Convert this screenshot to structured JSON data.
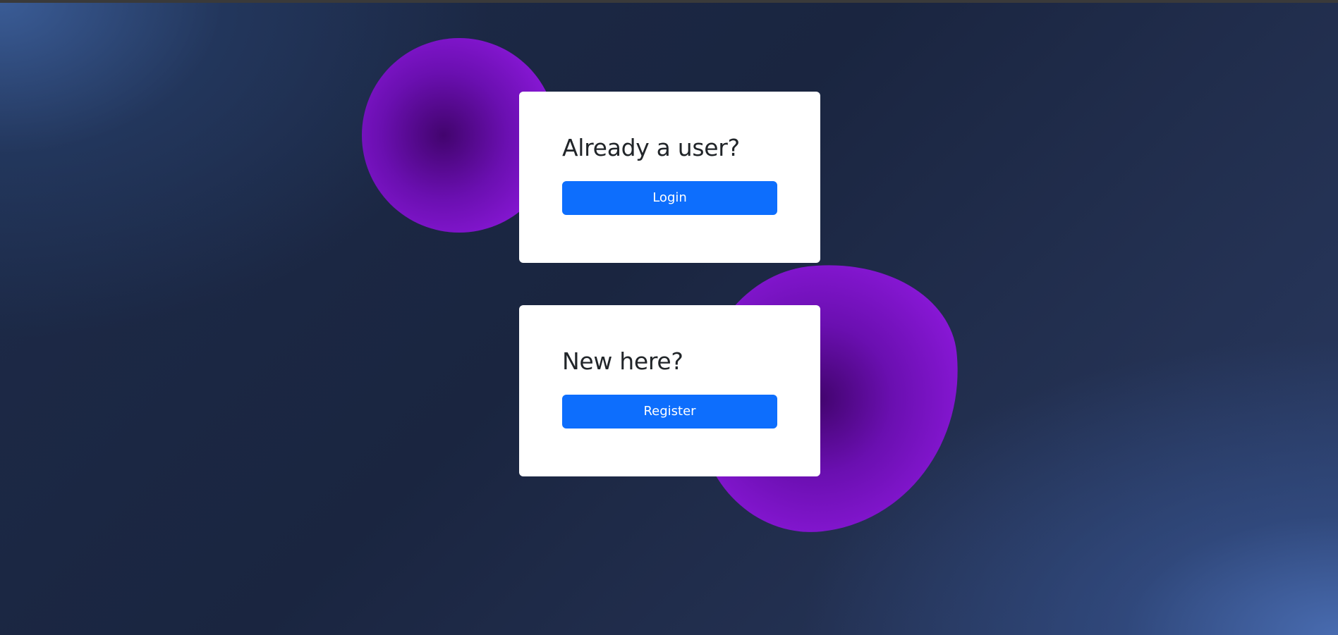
{
  "login_card": {
    "heading": "Already a user?",
    "button_label": "Login"
  },
  "register_card": {
    "heading": "New here?",
    "button_label": "Register"
  },
  "colors": {
    "primary_button": "#0d6efd",
    "card_background": "#ffffff",
    "heading_text": "#212529",
    "blob_purple": "#8a18d8",
    "background_dark": "#1a2540"
  }
}
